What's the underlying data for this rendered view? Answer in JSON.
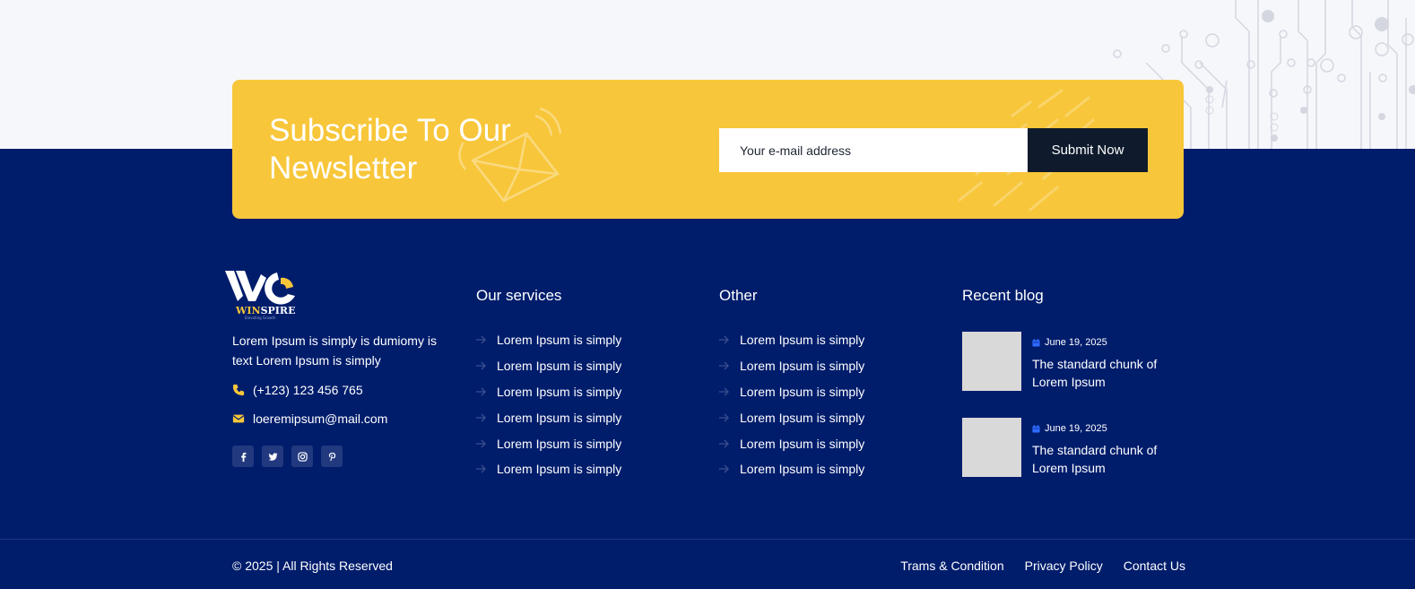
{
  "colors": {
    "navy": "#001d6c",
    "yellow": "#f8c63a",
    "dark_button": "#0f1b2d",
    "page_bg": "#f6f7fb",
    "thumb_gray": "#d9d9d9"
  },
  "newsletter": {
    "title": "Subscribe To Our Newsletter",
    "email_placeholder": "Your e-mail address",
    "submit_label": "Submit Now"
  },
  "brand": {
    "name": "WINSPIRE",
    "tagline": "Elevating Growth"
  },
  "about": {
    "text": "Lorem Ipsum is simply is dumiomy is text Lorem Ipsum is simply",
    "phone": "(+123) 123 456 765",
    "email": "loeremipsum@mail.com"
  },
  "socials": [
    "facebook-icon",
    "twitter-icon",
    "instagram-icon",
    "pinterest-icon"
  ],
  "services": {
    "title": "Our services",
    "items": [
      "Lorem Ipsum is simply",
      "Lorem Ipsum is simply",
      "Lorem Ipsum is simply",
      "Lorem Ipsum is simply",
      "Lorem Ipsum is simply",
      "Lorem Ipsum is simply"
    ]
  },
  "other": {
    "title": "Other",
    "items": [
      "Lorem Ipsum is simply",
      "Lorem Ipsum is simply",
      "Lorem Ipsum is simply",
      "Lorem Ipsum is simply",
      "Lorem Ipsum is simply",
      "Lorem Ipsum is simply"
    ]
  },
  "blog": {
    "title": "Recent blog",
    "posts": [
      {
        "date": "June 19, 2025",
        "title": "The standard chunk of Lorem Ipsum"
      },
      {
        "date": "June 19, 2025",
        "title": "The standard chunk of Lorem Ipsum"
      }
    ]
  },
  "bottom": {
    "copyright": "© 2025 | All Rights Reserved",
    "links": [
      "Trams & Condition",
      "Privacy Policy",
      "Contact Us"
    ]
  }
}
